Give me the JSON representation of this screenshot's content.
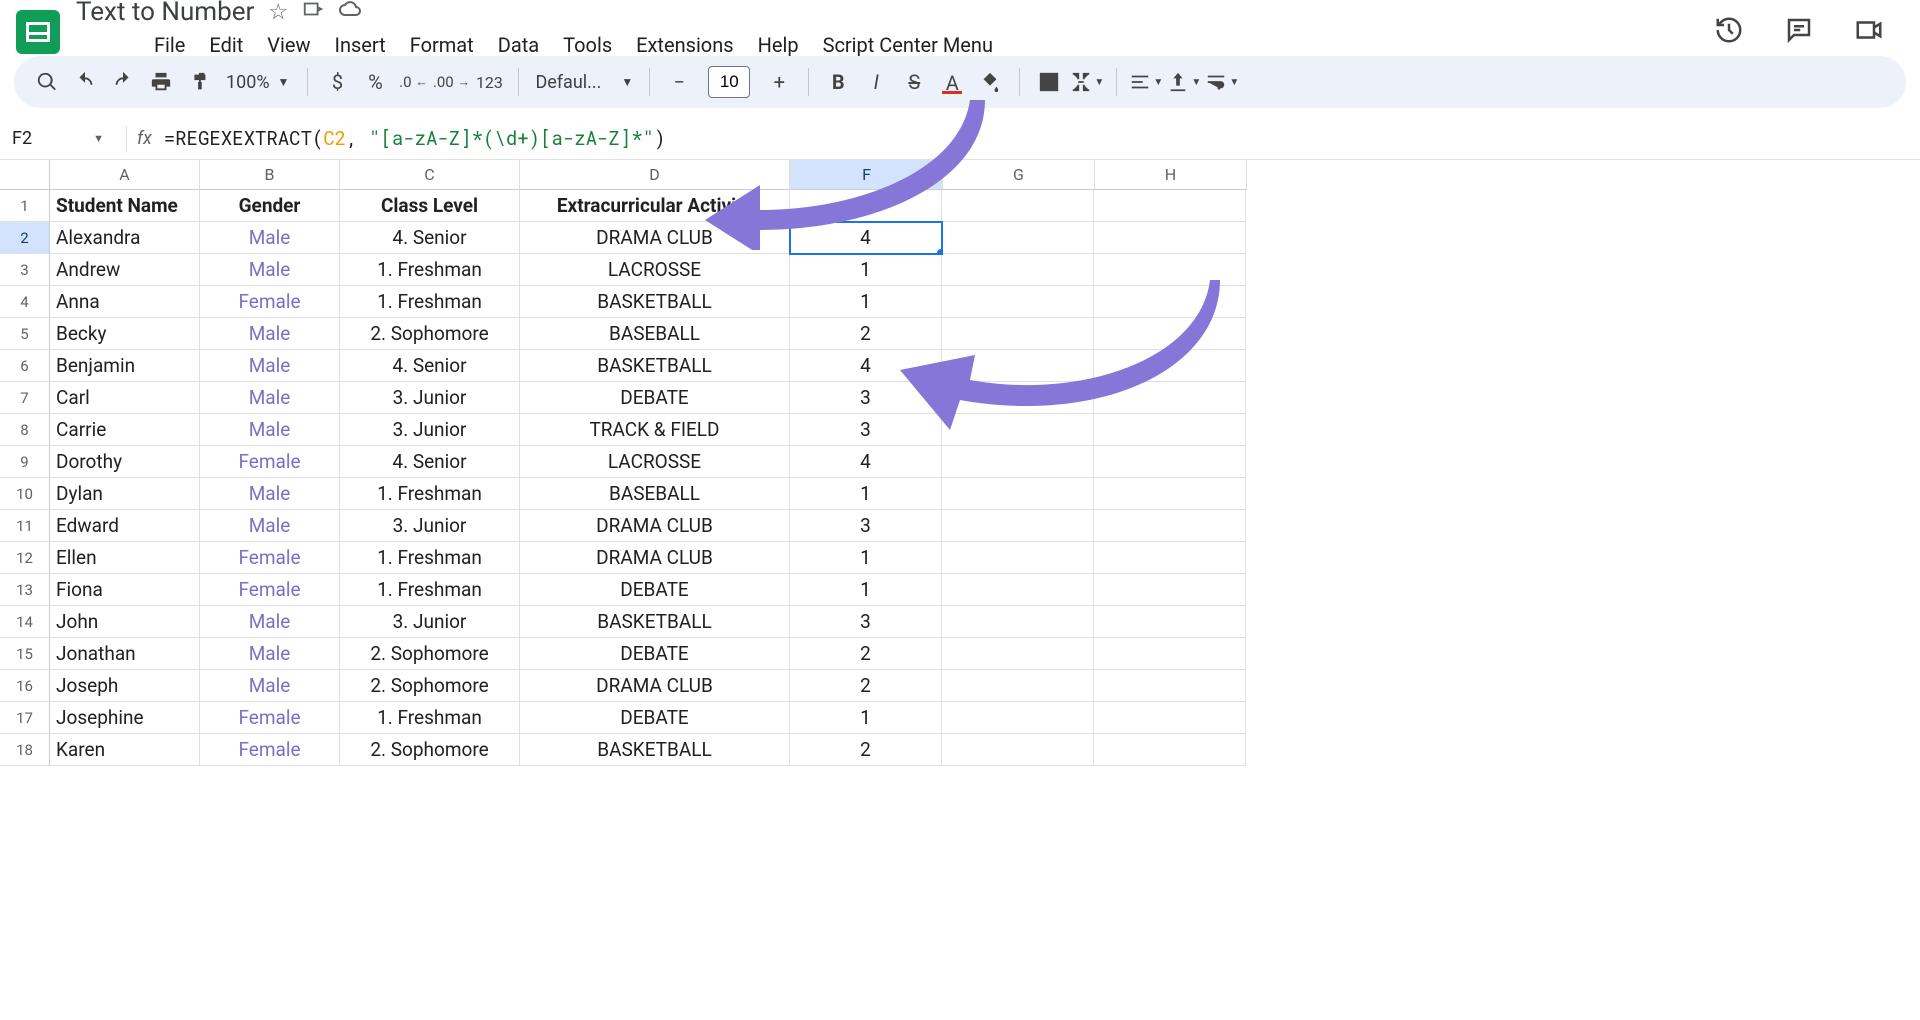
{
  "doc": {
    "title": "Text to Number"
  },
  "menus": [
    "File",
    "Edit",
    "View",
    "Insert",
    "Format",
    "Data",
    "Tools",
    "Extensions",
    "Help",
    "Script Center Menu"
  ],
  "toolbar": {
    "zoom": "100%",
    "font": "Defaul...",
    "fontsize": "10"
  },
  "namebox": "F2",
  "formula": {
    "prefix": "=REGEXEXTRACT(",
    "cellref": "C2",
    "comma": ", ",
    "regex": "\"[a-zA-Z]*(\\d+)[a-zA-Z]*\"",
    "suffix": ")"
  },
  "columns": [
    "A",
    "B",
    "C",
    "D",
    "",
    "F",
    "G",
    "H"
  ],
  "headers": {
    "A": "Student Name",
    "B": "Gender",
    "C": "Class Level",
    "D": "Extracurricular Activity"
  },
  "rows": [
    {
      "n": "Alexandra",
      "g": "Male",
      "c": "4. Senior",
      "d": "DRAMA CLUB",
      "f": "4"
    },
    {
      "n": "Andrew",
      "g": "Male",
      "c": "1. Freshman",
      "d": "LACROSSE",
      "f": "1"
    },
    {
      "n": "Anna",
      "g": "Female",
      "c": "1. Freshman",
      "d": "BASKETBALL",
      "f": "1"
    },
    {
      "n": "Becky",
      "g": "Male",
      "c": "2. Sophomore",
      "d": "BASEBALL",
      "f": "2"
    },
    {
      "n": "Benjamin",
      "g": "Male",
      "c": "4. Senior",
      "d": "BASKETBALL",
      "f": "4"
    },
    {
      "n": "Carl",
      "g": "Male",
      "c": "3. Junior",
      "d": "DEBATE",
      "f": "3"
    },
    {
      "n": "Carrie",
      "g": "Male",
      "c": "3. Junior",
      "d": "TRACK & FIELD",
      "f": "3"
    },
    {
      "n": "Dorothy",
      "g": "Female",
      "c": "4. Senior",
      "d": "LACROSSE",
      "f": "4"
    },
    {
      "n": "Dylan",
      "g": "Male",
      "c": "1. Freshman",
      "d": "BASEBALL",
      "f": "1"
    },
    {
      "n": "Edward",
      "g": "Male",
      "c": "3. Junior",
      "d": "DRAMA CLUB",
      "f": "3"
    },
    {
      "n": "Ellen",
      "g": "Female",
      "c": "1. Freshman",
      "d": "DRAMA CLUB",
      "f": "1"
    },
    {
      "n": "Fiona",
      "g": "Female",
      "c": "1. Freshman",
      "d": "DEBATE",
      "f": "1"
    },
    {
      "n": "John",
      "g": "Male",
      "c": "3. Junior",
      "d": "BASKETBALL",
      "f": "3"
    },
    {
      "n": "Jonathan",
      "g": "Male",
      "c": "2. Sophomore",
      "d": "DEBATE",
      "f": "2"
    },
    {
      "n": "Joseph",
      "g": "Male",
      "c": "2. Sophomore",
      "d": "DRAMA CLUB",
      "f": "2"
    },
    {
      "n": "Josephine",
      "g": "Female",
      "c": "1. Freshman",
      "d": "DEBATE",
      "f": "1"
    },
    {
      "n": "Karen",
      "g": "Female",
      "c": "2. Sophomore",
      "d": "BASKETBALL",
      "f": "2"
    }
  ],
  "selected": {
    "cell": "F2",
    "row": 2,
    "col": "F"
  }
}
